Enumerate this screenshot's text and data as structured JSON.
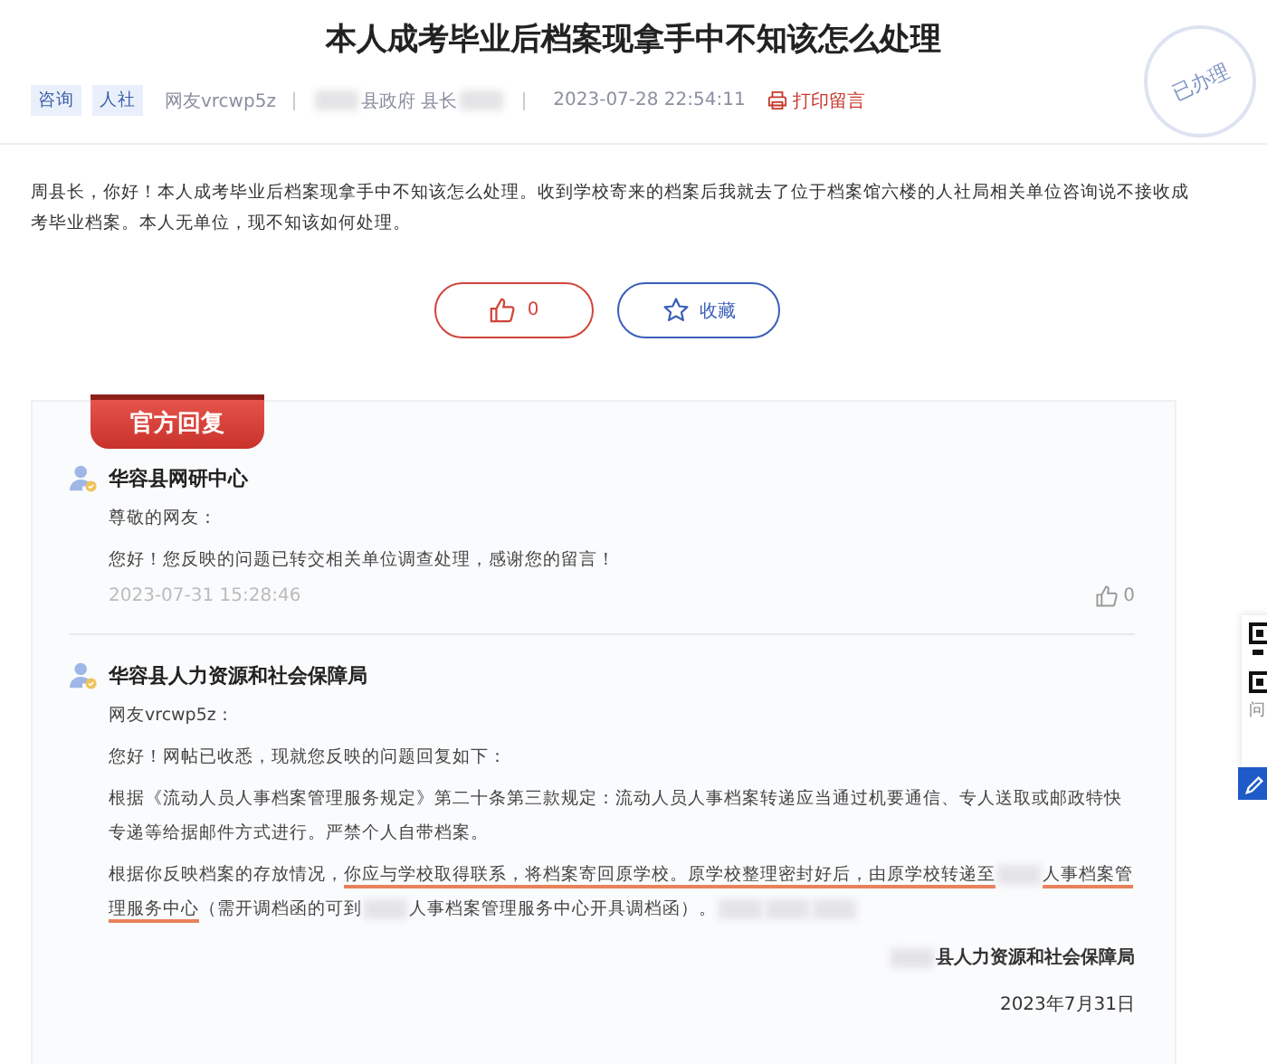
{
  "title": "本人成考毕业后档案现拿手中不知该怎么处理",
  "tags": [
    "咨询",
    "人社"
  ],
  "author": "网友vrcwp5z",
  "recipient": [
    {
      "kind": "redacted"
    },
    {
      "kind": "text",
      "text": "县政府 县长"
    },
    {
      "kind": "redacted"
    }
  ],
  "time": "2023-07-28 22:54:11",
  "print_link": "打印留言",
  "stamp": "已办理",
  "question": "周县长，你好！本人成考毕业后档案现拿手中不知该怎么处理。收到学校寄来的档案后我就去了位于档案馆六楼的人社局相关单位咨询说不接收成考毕业档案。本人无单位，现不知该如何处理。",
  "actions": [
    {
      "kind": "like",
      "label": "0"
    },
    {
      "kind": "favorite",
      "label": "收藏"
    }
  ],
  "reply_banner": "官方回复",
  "replies": [
    {
      "org": "华容县网研中心",
      "paragraphs": [
        [
          {
            "kind": "text",
            "text": "尊敬的网友："
          }
        ],
        [
          {
            "kind": "text",
            "text": "您好！您反映的问题已转交相关单位调查处理，感谢您的留言！"
          }
        ]
      ],
      "time": "2023-07-31 15:28:46",
      "likes": "0"
    },
    {
      "org": "华容县人力资源和社会保障局",
      "paragraphs": [
        [
          {
            "kind": "text",
            "text": "网友vrcwp5z："
          }
        ],
        [
          {
            "kind": "text",
            "text": "您好！网帖已收悉，现就您反映的问题回复如下："
          }
        ],
        [
          {
            "kind": "text",
            "text": "根据《流动人员人事档案管理服务规定》第二十条第三款规定：流动人员人事档案转递应当通过机要通信、专人送取或邮政特快专递等给据邮件方式进行。严禁个人自带档案。"
          }
        ],
        [
          {
            "kind": "text",
            "text": "根据你反映档案的存放情况，"
          },
          {
            "kind": "underline",
            "text": "你应与学校取得联系，将档案寄回原学校。原学校整理密封好后，由原学校转递至"
          },
          {
            "kind": "redacted"
          },
          {
            "kind": "underline",
            "text": "人事档案管理服务中心"
          },
          {
            "kind": "text",
            "text": "（需开调档函的可到"
          },
          {
            "kind": "redacted"
          },
          {
            "kind": "text",
            "text": "人事档案管理服务中心开具调档函）。"
          },
          {
            "kind": "redacted"
          },
          {
            "kind": "redacted"
          },
          {
            "kind": "redacted"
          }
        ]
      ],
      "signature": [
        {
          "kind": "redacted"
        },
        {
          "kind": "text",
          "text": "县人力资源和社会保障局"
        }
      ],
      "date": "2023年7月31日"
    }
  ],
  "side_widget": {
    "caption": "问"
  }
}
